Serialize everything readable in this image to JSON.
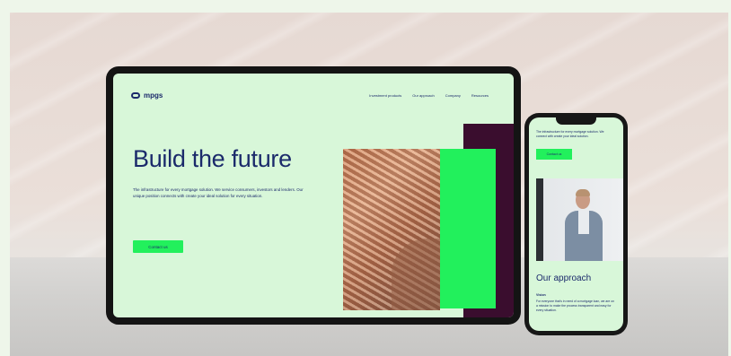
{
  "tablet": {
    "logo_text": "mpgs",
    "nav_items": [
      "Investment products",
      "Our approach",
      "Company",
      "Resources"
    ],
    "hero_title": "Build the future",
    "hero_body": "The infrastructure for every mortgage solution. We service consumers, investors and lenders. Our unique position connects with create your ideal solution for every situation.",
    "cta_label": "Contact us"
  },
  "phone": {
    "body_text": "The infrastructure for every mortgage solution. We connect with create your ideal solution.",
    "cta_label": "Contact us",
    "section_heading": "Our approach",
    "section_sub": "Vision",
    "section_text": "For everyone that's in need of a mortgage loan, we are on a mission to make the process transparent and easy for every situation."
  },
  "colors": {
    "navy": "#1b2a6b",
    "mint": "#d8f7d9",
    "green": "#22f05c",
    "plum": "#3a0d2e"
  }
}
